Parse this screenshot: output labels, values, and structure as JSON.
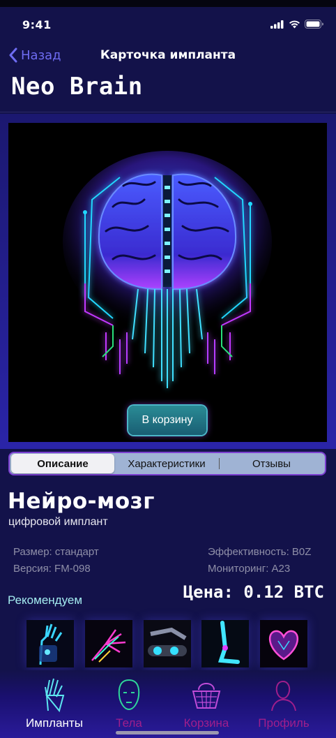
{
  "status_bar": {
    "time": "9:41"
  },
  "nav": {
    "back_label": "Назад",
    "title": "Карточка импланта"
  },
  "page_title": "Neo Brain",
  "hero": {
    "image": "glowing-neon-brain-chip",
    "cart_button": "В корзину"
  },
  "tabs": [
    {
      "label": "Описание",
      "active": true
    },
    {
      "label": "Характеристики",
      "active": false
    },
    {
      "label": "Отзывы",
      "active": false
    }
  ],
  "product": {
    "name": "Нейро-мозг",
    "subtitle": "цифровой имплант",
    "specs_left": [
      "Размер: стандарт",
      "Версия: FM-098"
    ],
    "specs_right": [
      "Эффективность: B0Z",
      "Мониторинг: A23"
    ],
    "price": "Цена: 0.12 BTC"
  },
  "recommend": {
    "label": "Рекомендуем",
    "items": [
      "neon-robotic-hand",
      "neon-hand-wires",
      "robotic-arm-joints",
      "neon-robot-leg",
      "neon-heart"
    ]
  },
  "tab_bar": [
    {
      "label": "Импланты",
      "icon": "hand-icon",
      "color": "#ffffff"
    },
    {
      "label": "Тела",
      "icon": "face-icon",
      "color": "#a01e8c"
    },
    {
      "label": "Корзина",
      "icon": "basket-icon",
      "color": "#a01e8c"
    },
    {
      "label": "Профиль",
      "icon": "profile-icon",
      "color": "#a01e8c"
    }
  ],
  "colors": {
    "background": "#13124a",
    "accent_blue": "#6e6cf2",
    "accent_cyan": "#a4ecf0",
    "inactive_tab": "#a01e8c"
  }
}
